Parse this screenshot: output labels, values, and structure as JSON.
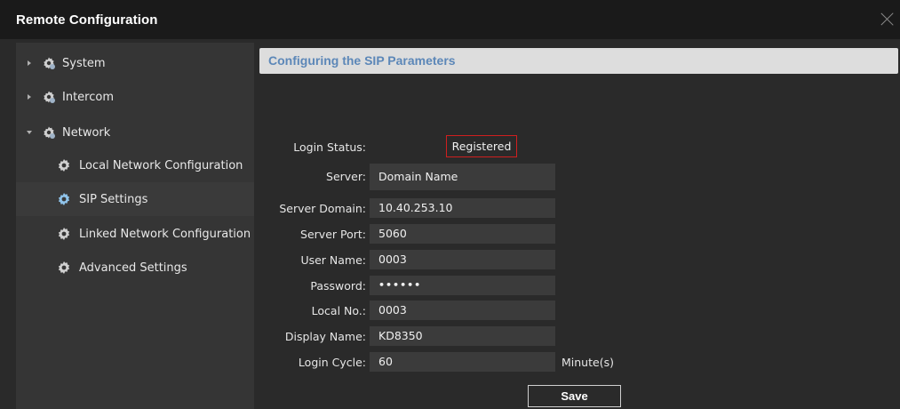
{
  "window": {
    "title": "Remote Configuration"
  },
  "sidebar": {
    "items": [
      {
        "label": "System",
        "expanded": false,
        "icon": "gear-folder-icon"
      },
      {
        "label": "Intercom",
        "expanded": false,
        "icon": "gear-folder-icon"
      },
      {
        "label": "Network",
        "expanded": true,
        "icon": "gear-folder-icon"
      }
    ],
    "children": [
      {
        "label": "Local Network Configuration",
        "icon": "gear-icon"
      },
      {
        "label": "SIP Settings",
        "icon": "gear-icon",
        "selected": true
      },
      {
        "label": "Linked Network Configuration",
        "icon": "gear-icon"
      },
      {
        "label": "Advanced Settings",
        "icon": "gear-icon"
      }
    ]
  },
  "main": {
    "header": "Configuring the SIP Parameters",
    "login_status": {
      "label": "Login Status:",
      "value": "Registered"
    },
    "fields": [
      {
        "label": "Server:",
        "value": "Domain Name"
      },
      {
        "label": "Server Domain:",
        "value": "10.40.253.10"
      },
      {
        "label": "Server Port:",
        "value": "5060"
      },
      {
        "label": "User Name:",
        "value": "0003"
      },
      {
        "label": "Password:",
        "value": "••••••"
      },
      {
        "label": "Local No.:",
        "value": "0003"
      },
      {
        "label": "Display Name:",
        "value": "KD8350"
      },
      {
        "label": "Login Cycle:",
        "value": "60"
      }
    ],
    "login_cycle_unit": "Minute(s)",
    "save_label": "Save"
  },
  "colors": {
    "header_text": "#5c87b8",
    "status_border": "#d01f1f",
    "sidebar_bg": "#353535",
    "titlebar_bg": "#1a1a1a"
  }
}
